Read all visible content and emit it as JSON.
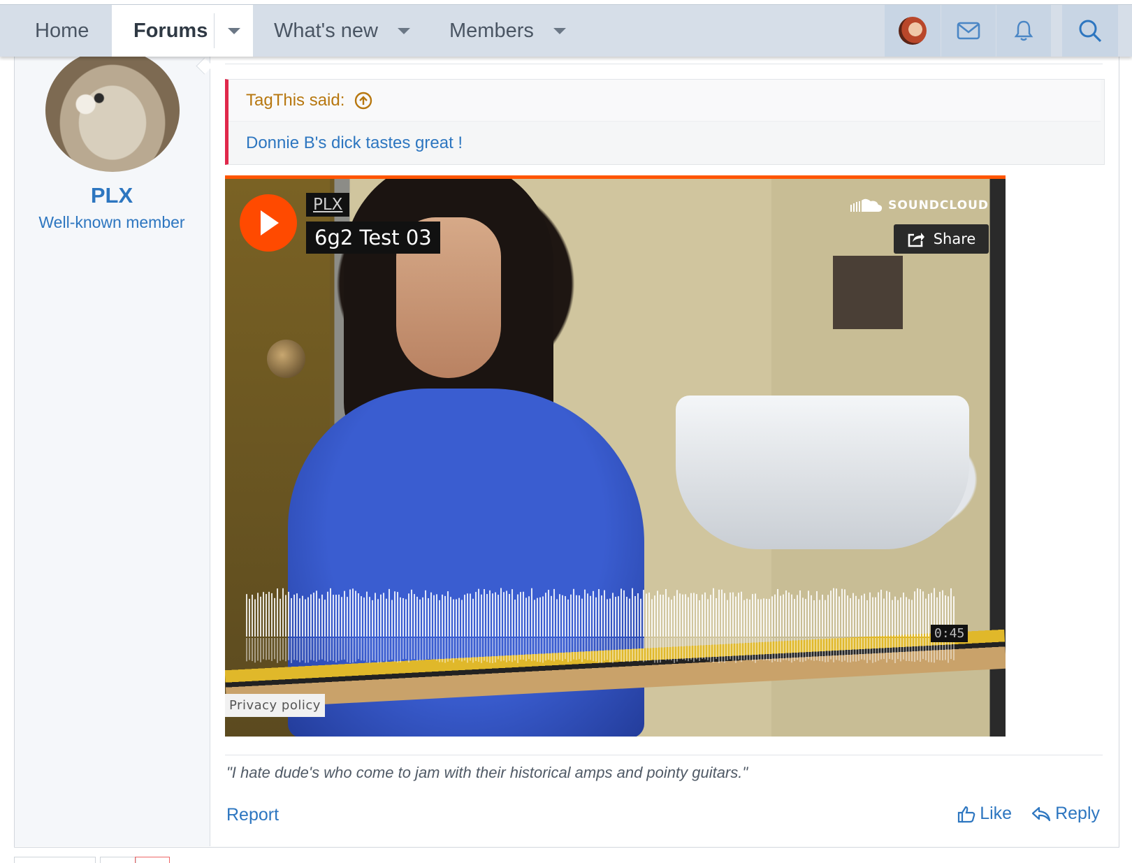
{
  "nav": {
    "home": "Home",
    "forums": "Forums",
    "whats_new": "What's new",
    "members": "Members"
  },
  "icons": {
    "mail": "mail-icon",
    "bell": "bell-icon",
    "search": "search-icon",
    "upvote": "arrow-up-circle-icon",
    "play": "play-icon",
    "share": "share-icon",
    "like": "thumbs-up-icon",
    "reply": "reply-icon"
  },
  "colors": {
    "accent": "#2d76c0",
    "quote_border": "#e0284b",
    "quote_author": "#b7770f",
    "soundcloud": "#ff5500"
  },
  "user": {
    "name": "PLX",
    "title": "Well-known member"
  },
  "quote": {
    "author": "TagThis said:",
    "text": "Donnie B's dick tastes great !"
  },
  "embed": {
    "uploader": "PLX",
    "track_title": "6g2 Test 03",
    "brand": "SOUNDCLOUD",
    "share_label": "Share",
    "duration": "0:45",
    "privacy": "Privacy policy"
  },
  "signature": "\"I hate dude's who come to jam with their historical amps and pointy guitars.\"",
  "actions": {
    "report": "Report",
    "like": "Like",
    "reply": "Reply"
  }
}
